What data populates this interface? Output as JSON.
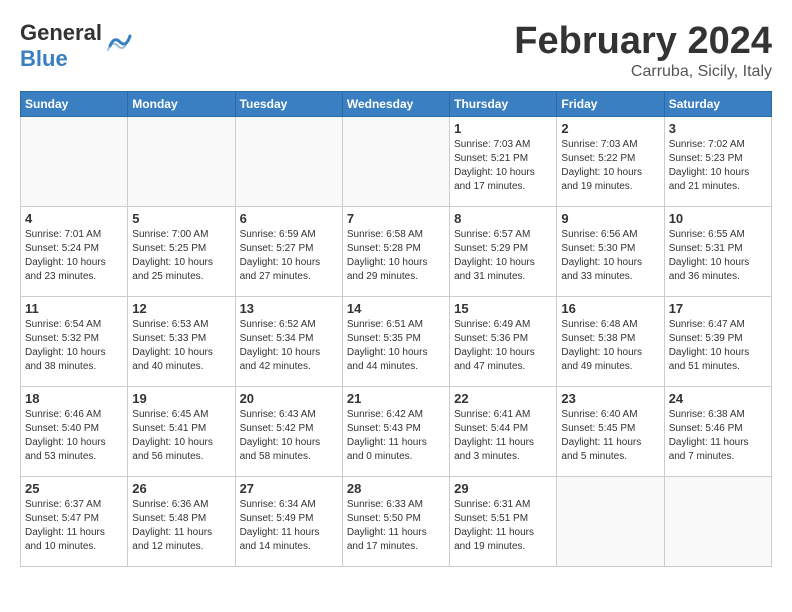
{
  "logo": {
    "general": "General",
    "blue": "Blue"
  },
  "header": {
    "month": "February 2024",
    "location": "Carruba, Sicily, Italy"
  },
  "weekdays": [
    "Sunday",
    "Monday",
    "Tuesday",
    "Wednesday",
    "Thursday",
    "Friday",
    "Saturday"
  ],
  "weeks": [
    [
      {
        "day": "",
        "info": ""
      },
      {
        "day": "",
        "info": ""
      },
      {
        "day": "",
        "info": ""
      },
      {
        "day": "",
        "info": ""
      },
      {
        "day": "1",
        "info": "Sunrise: 7:03 AM\nSunset: 5:21 PM\nDaylight: 10 hours\nand 17 minutes."
      },
      {
        "day": "2",
        "info": "Sunrise: 7:03 AM\nSunset: 5:22 PM\nDaylight: 10 hours\nand 19 minutes."
      },
      {
        "day": "3",
        "info": "Sunrise: 7:02 AM\nSunset: 5:23 PM\nDaylight: 10 hours\nand 21 minutes."
      }
    ],
    [
      {
        "day": "4",
        "info": "Sunrise: 7:01 AM\nSunset: 5:24 PM\nDaylight: 10 hours\nand 23 minutes."
      },
      {
        "day": "5",
        "info": "Sunrise: 7:00 AM\nSunset: 5:25 PM\nDaylight: 10 hours\nand 25 minutes."
      },
      {
        "day": "6",
        "info": "Sunrise: 6:59 AM\nSunset: 5:27 PM\nDaylight: 10 hours\nand 27 minutes."
      },
      {
        "day": "7",
        "info": "Sunrise: 6:58 AM\nSunset: 5:28 PM\nDaylight: 10 hours\nand 29 minutes."
      },
      {
        "day": "8",
        "info": "Sunrise: 6:57 AM\nSunset: 5:29 PM\nDaylight: 10 hours\nand 31 minutes."
      },
      {
        "day": "9",
        "info": "Sunrise: 6:56 AM\nSunset: 5:30 PM\nDaylight: 10 hours\nand 33 minutes."
      },
      {
        "day": "10",
        "info": "Sunrise: 6:55 AM\nSunset: 5:31 PM\nDaylight: 10 hours\nand 36 minutes."
      }
    ],
    [
      {
        "day": "11",
        "info": "Sunrise: 6:54 AM\nSunset: 5:32 PM\nDaylight: 10 hours\nand 38 minutes."
      },
      {
        "day": "12",
        "info": "Sunrise: 6:53 AM\nSunset: 5:33 PM\nDaylight: 10 hours\nand 40 minutes."
      },
      {
        "day": "13",
        "info": "Sunrise: 6:52 AM\nSunset: 5:34 PM\nDaylight: 10 hours\nand 42 minutes."
      },
      {
        "day": "14",
        "info": "Sunrise: 6:51 AM\nSunset: 5:35 PM\nDaylight: 10 hours\nand 44 minutes."
      },
      {
        "day": "15",
        "info": "Sunrise: 6:49 AM\nSunset: 5:36 PM\nDaylight: 10 hours\nand 47 minutes."
      },
      {
        "day": "16",
        "info": "Sunrise: 6:48 AM\nSunset: 5:38 PM\nDaylight: 10 hours\nand 49 minutes."
      },
      {
        "day": "17",
        "info": "Sunrise: 6:47 AM\nSunset: 5:39 PM\nDaylight: 10 hours\nand 51 minutes."
      }
    ],
    [
      {
        "day": "18",
        "info": "Sunrise: 6:46 AM\nSunset: 5:40 PM\nDaylight: 10 hours\nand 53 minutes."
      },
      {
        "day": "19",
        "info": "Sunrise: 6:45 AM\nSunset: 5:41 PM\nDaylight: 10 hours\nand 56 minutes."
      },
      {
        "day": "20",
        "info": "Sunrise: 6:43 AM\nSunset: 5:42 PM\nDaylight: 10 hours\nand 58 minutes."
      },
      {
        "day": "21",
        "info": "Sunrise: 6:42 AM\nSunset: 5:43 PM\nDaylight: 11 hours\nand 0 minutes."
      },
      {
        "day": "22",
        "info": "Sunrise: 6:41 AM\nSunset: 5:44 PM\nDaylight: 11 hours\nand 3 minutes."
      },
      {
        "day": "23",
        "info": "Sunrise: 6:40 AM\nSunset: 5:45 PM\nDaylight: 11 hours\nand 5 minutes."
      },
      {
        "day": "24",
        "info": "Sunrise: 6:38 AM\nSunset: 5:46 PM\nDaylight: 11 hours\nand 7 minutes."
      }
    ],
    [
      {
        "day": "25",
        "info": "Sunrise: 6:37 AM\nSunset: 5:47 PM\nDaylight: 11 hours\nand 10 minutes."
      },
      {
        "day": "26",
        "info": "Sunrise: 6:36 AM\nSunset: 5:48 PM\nDaylight: 11 hours\nand 12 minutes."
      },
      {
        "day": "27",
        "info": "Sunrise: 6:34 AM\nSunset: 5:49 PM\nDaylight: 11 hours\nand 14 minutes."
      },
      {
        "day": "28",
        "info": "Sunrise: 6:33 AM\nSunset: 5:50 PM\nDaylight: 11 hours\nand 17 minutes."
      },
      {
        "day": "29",
        "info": "Sunrise: 6:31 AM\nSunset: 5:51 PM\nDaylight: 11 hours\nand 19 minutes."
      },
      {
        "day": "",
        "info": ""
      },
      {
        "day": "",
        "info": ""
      }
    ]
  ]
}
